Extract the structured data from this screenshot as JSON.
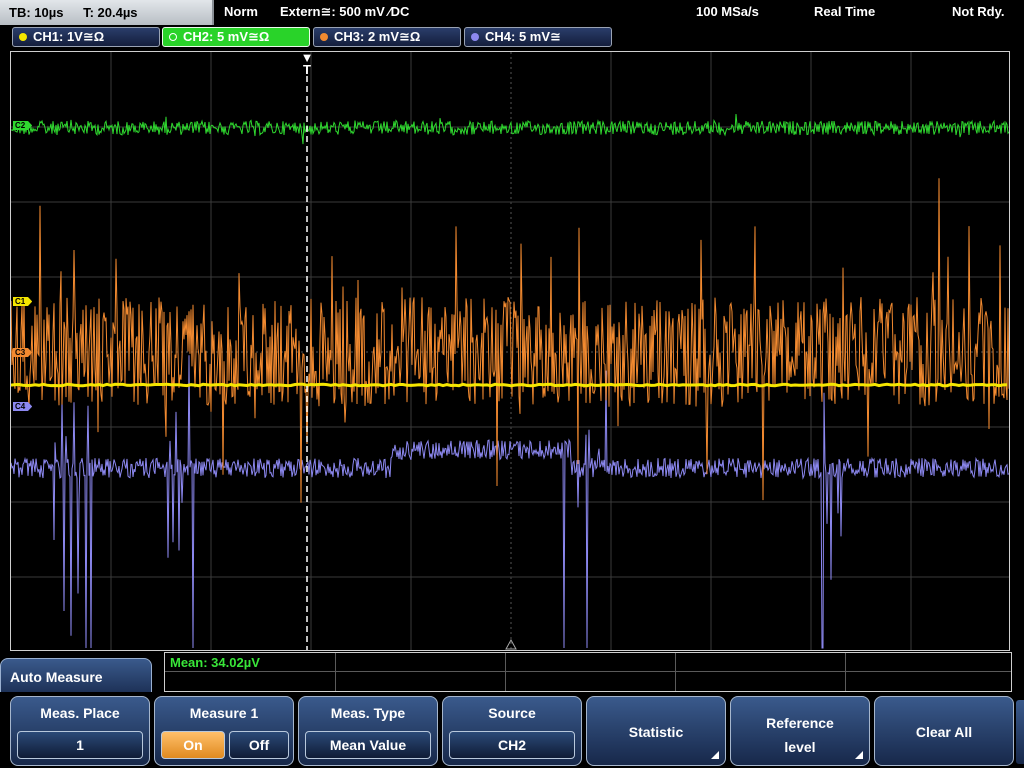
{
  "topbar": {
    "timebase": "TB: 10µs",
    "trigger_time": "T: 20.4µs",
    "mode": "Norm",
    "trigger": "Extern≅: 500 mV ⁄DC",
    "sample_rate": "100 MSa/s",
    "acq_mode": "Real Time",
    "status": "Not Rdy."
  },
  "channels": [
    {
      "label": "CH1: 1V≅Ω",
      "color": "#f5e600",
      "marker": "C1"
    },
    {
      "label": "CH2: 5 mV≅Ω",
      "color": "#2fd92f",
      "marker": "C2"
    },
    {
      "label": "CH3: 2 mV≅Ω",
      "color": "#f28a30",
      "marker": "C3"
    },
    {
      "label": "CH4: 5 mV≅",
      "color": "#8c88f0",
      "marker": "C4"
    }
  ],
  "trigger_marker": "T",
  "measurement": {
    "result": "Mean: 34.02µV"
  },
  "menu": {
    "title": "Auto Measure",
    "keys": {
      "meas_place": {
        "label": "Meas. Place",
        "value": "1"
      },
      "measure1": {
        "label": "Measure 1",
        "on": "On",
        "off": "Off"
      },
      "meas_type": {
        "label": "Meas. Type",
        "value": "Mean Value"
      },
      "source": {
        "label": "Source",
        "value": "CH2"
      },
      "statistic": {
        "label": "Statistic"
      },
      "reference": {
        "label1": "Reference",
        "label2": "level"
      },
      "clear_all": {
        "label": "Clear All"
      }
    }
  }
}
